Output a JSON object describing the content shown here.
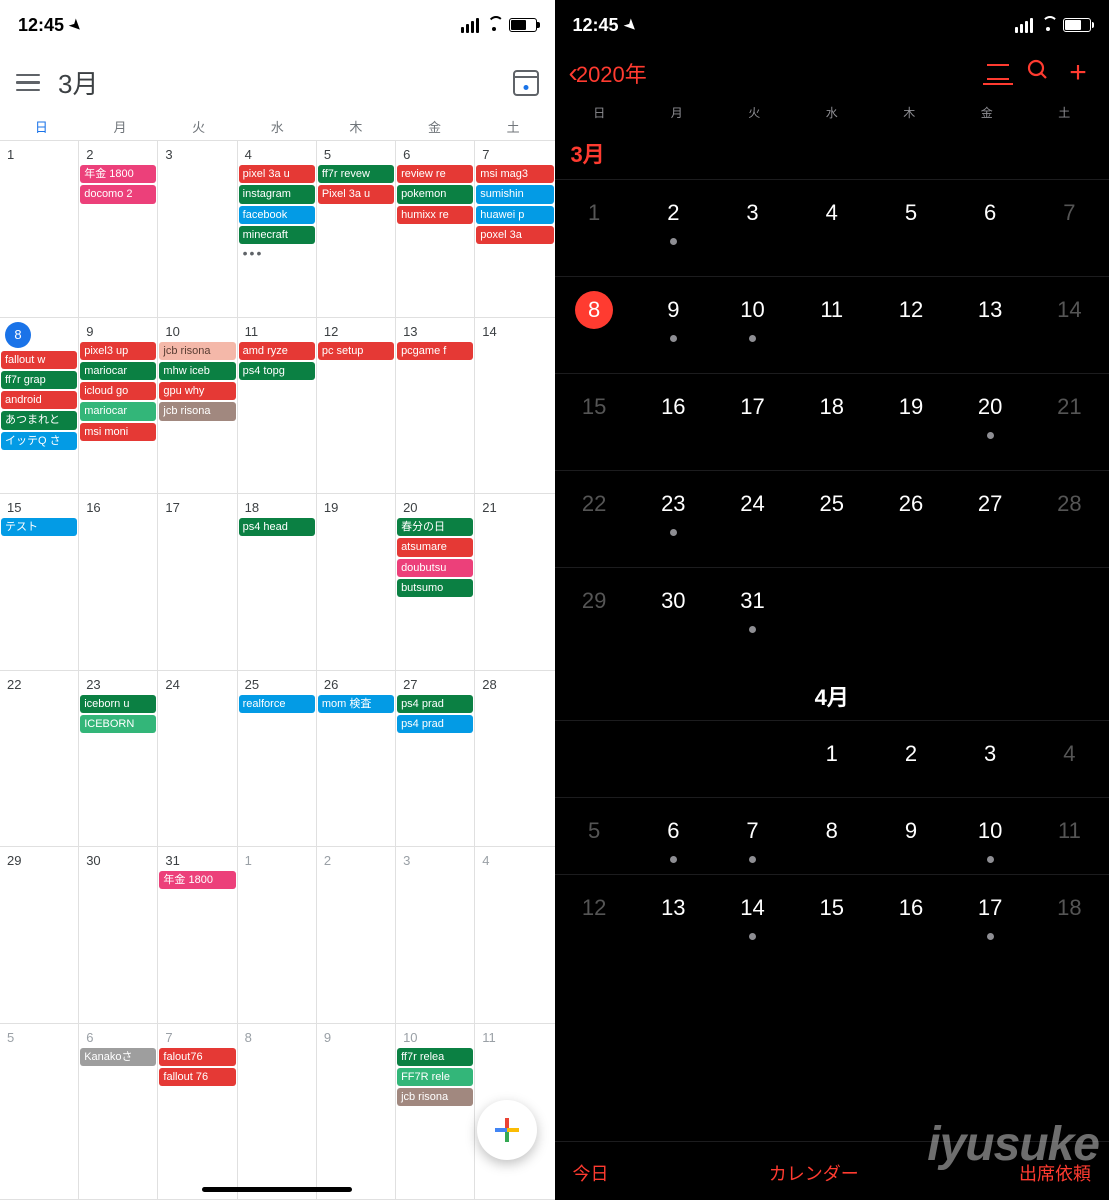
{
  "status": {
    "time": "12:45"
  },
  "google": {
    "title": "3月",
    "wdays": [
      "日",
      "月",
      "火",
      "水",
      "木",
      "金",
      "土"
    ],
    "today": 8,
    "rows": [
      [
        {
          "n": 1
        },
        {
          "n": 2,
          "ev": [
            {
              "t": "年金 1800",
              "c": "c-hotpink"
            },
            {
              "t": "docomo 2",
              "c": "c-hotpink"
            }
          ]
        },
        {
          "n": 3
        },
        {
          "n": 4,
          "ev": [
            {
              "t": "pixel 3a u",
              "c": "c-red"
            },
            {
              "t": "instagram",
              "c": "c-green"
            },
            {
              "t": "facebook",
              "c": "c-lblue"
            },
            {
              "t": "minecraft",
              "c": "c-green"
            }
          ],
          "more": true
        },
        {
          "n": 5,
          "ev": [
            {
              "t": "ff7r revew",
              "c": "c-green"
            },
            {
              "t": "Pixel 3a u",
              "c": "c-red"
            }
          ]
        },
        {
          "n": 6,
          "ev": [
            {
              "t": "review re",
              "c": "c-red"
            },
            {
              "t": "pokemon",
              "c": "c-green"
            },
            {
              "t": "humixx re",
              "c": "c-red"
            }
          ]
        },
        {
          "n": 7,
          "ev": [
            {
              "t": "msi mag3",
              "c": "c-red"
            },
            {
              "t": "sumishin",
              "c": "c-lblue"
            },
            {
              "t": "huawei p",
              "c": "c-lblue"
            },
            {
              "t": "poxel 3a",
              "c": "c-red"
            }
          ]
        }
      ],
      [
        {
          "n": 8,
          "today": true,
          "ev": [
            {
              "t": "fallout w",
              "c": "c-red"
            },
            {
              "t": "ff7r grap",
              "c": "c-green"
            },
            {
              "t": "android",
              "c": "c-red"
            },
            {
              "t": "あつまれと",
              "c": "c-green"
            },
            {
              "t": "イッテQ さ",
              "c": "c-lblue"
            }
          ]
        },
        {
          "n": 9,
          "ev": [
            {
              "t": "pixel3 up",
              "c": "c-red"
            },
            {
              "t": "mariocar",
              "c": "c-green"
            },
            {
              "t": "icloud go",
              "c": "c-red"
            },
            {
              "t": "mariocar",
              "c": "c-green2"
            },
            {
              "t": "msi moni",
              "c": "c-red"
            }
          ]
        },
        {
          "n": 10,
          "ev": [
            {
              "t": "jcb risona",
              "c": "c-salmon"
            },
            {
              "t": "mhw iceb",
              "c": "c-green"
            },
            {
              "t": "gpu why",
              "c": "c-red"
            },
            {
              "t": "jcb risona",
              "c": "c-tan"
            }
          ]
        },
        {
          "n": 11,
          "ev": [
            {
              "t": "amd ryze",
              "c": "c-red"
            },
            {
              "t": "ps4 topg",
              "c": "c-green"
            }
          ]
        },
        {
          "n": 12,
          "ev": [
            {
              "t": "pc setup",
              "c": "c-red"
            }
          ]
        },
        {
          "n": 13,
          "ev": [
            {
              "t": "pcgame f",
              "c": "c-red"
            }
          ]
        },
        {
          "n": 14
        }
      ],
      [
        {
          "n": 15,
          "ev": [
            {
              "t": "テスト",
              "c": "c-lblue"
            }
          ]
        },
        {
          "n": 16
        },
        {
          "n": 17
        },
        {
          "n": 18,
          "ev": [
            {
              "t": "ps4 head",
              "c": "c-green"
            }
          ]
        },
        {
          "n": 19
        },
        {
          "n": 20,
          "ev": [
            {
              "t": "春分の日",
              "c": "c-green"
            },
            {
              "t": "atsumare",
              "c": "c-red"
            },
            {
              "t": "doubutsu",
              "c": "c-hotpink"
            },
            {
              "t": "butsumo",
              "c": "c-green"
            }
          ]
        },
        {
          "n": 21
        }
      ],
      [
        {
          "n": 22
        },
        {
          "n": 23,
          "ev": [
            {
              "t": "iceborn u",
              "c": "c-green"
            },
            {
              "t": "ICEBORN",
              "c": "c-green2"
            }
          ]
        },
        {
          "n": 24
        },
        {
          "n": 25,
          "ev": [
            {
              "t": "realforce",
              "c": "c-lblue"
            }
          ]
        },
        {
          "n": 26,
          "ev": [
            {
              "t": "mom 検査",
              "c": "c-lblue"
            }
          ]
        },
        {
          "n": 27,
          "ev": [
            {
              "t": "ps4 prad",
              "c": "c-green"
            },
            {
              "t": "ps4 prad",
              "c": "c-lblue"
            }
          ]
        },
        {
          "n": 28
        }
      ],
      [
        {
          "n": 29
        },
        {
          "n": 30
        },
        {
          "n": 31,
          "ev": [
            {
              "t": "年金 1800",
              "c": "c-hotpink"
            }
          ]
        },
        {
          "n": 1,
          "other": true
        },
        {
          "n": 2,
          "other": true
        },
        {
          "n": 3,
          "other": true
        },
        {
          "n": 4,
          "other": true
        }
      ],
      [
        {
          "n": 5,
          "other": true
        },
        {
          "n": 6,
          "other": true,
          "ev": [
            {
              "t": "Kanakoさ",
              "c": "c-grey"
            }
          ]
        },
        {
          "n": 7,
          "other": true,
          "ev": [
            {
              "t": "falout76",
              "c": "c-red"
            },
            {
              "t": "fallout 76",
              "c": "c-red"
            }
          ]
        },
        {
          "n": 8,
          "other": true
        },
        {
          "n": 9,
          "other": true
        },
        {
          "n": 10,
          "other": true,
          "ev": [
            {
              "t": "ff7r relea",
              "c": "c-green"
            },
            {
              "t": "FF7R rele",
              "c": "c-green2"
            },
            {
              "t": "jcb risona",
              "c": "c-tan"
            }
          ]
        },
        {
          "n": 11,
          "other": true
        }
      ]
    ]
  },
  "ios": {
    "back": "2020年",
    "wdays": [
      "日",
      "月",
      "火",
      "水",
      "木",
      "金",
      "土"
    ],
    "month1": "3月",
    "month2": "4月",
    "today": 8,
    "footer": {
      "today": "今日",
      "calendars": "カレンダー",
      "inbox": "出席依頼"
    },
    "rows1": [
      [
        {
          "n": 1,
          "dim": true
        },
        {
          "n": 2,
          "dot": true
        },
        {
          "n": 3
        },
        {
          "n": 4
        },
        {
          "n": 5
        },
        {
          "n": 6
        },
        {
          "n": 7,
          "dim": true
        }
      ],
      [
        {
          "n": 8,
          "today": true
        },
        {
          "n": 9,
          "dot": true
        },
        {
          "n": 10,
          "dot": true
        },
        {
          "n": 11
        },
        {
          "n": 12
        },
        {
          "n": 13
        },
        {
          "n": 14,
          "dim": true
        }
      ],
      [
        {
          "n": 15,
          "dim": true
        },
        {
          "n": 16
        },
        {
          "n": 17
        },
        {
          "n": 18
        },
        {
          "n": 19
        },
        {
          "n": 20,
          "dot": true
        },
        {
          "n": 21,
          "dim": true
        }
      ],
      [
        {
          "n": 22,
          "dim": true
        },
        {
          "n": 23,
          "dot": true
        },
        {
          "n": 24
        },
        {
          "n": 25
        },
        {
          "n": 26
        },
        {
          "n": 27
        },
        {
          "n": 28,
          "dim": true
        }
      ],
      [
        {
          "n": 29,
          "dim": true
        },
        {
          "n": 30
        },
        {
          "n": 31,
          "dot": true
        },
        {
          "n": ""
        },
        {
          "n": ""
        },
        {
          "n": ""
        },
        {
          "n": ""
        }
      ]
    ],
    "rows2": [
      [
        {
          "n": ""
        },
        {
          "n": ""
        },
        {
          "n": ""
        },
        {
          "n": 1
        },
        {
          "n": 2
        },
        {
          "n": 3
        },
        {
          "n": 4,
          "dim": true
        }
      ],
      [
        {
          "n": 5,
          "dim": true
        },
        {
          "n": 6,
          "dot": true
        },
        {
          "n": 7,
          "dot": true
        },
        {
          "n": 8
        },
        {
          "n": 9
        },
        {
          "n": 10,
          "dot": true
        },
        {
          "n": 11,
          "dim": true
        }
      ],
      [
        {
          "n": 12,
          "dim": true
        },
        {
          "n": 13
        },
        {
          "n": 14,
          "dot": true
        },
        {
          "n": 15
        },
        {
          "n": 16
        },
        {
          "n": 17,
          "dot": true
        },
        {
          "n": 18,
          "dim": true
        }
      ]
    ]
  },
  "watermark": "iyusuke"
}
